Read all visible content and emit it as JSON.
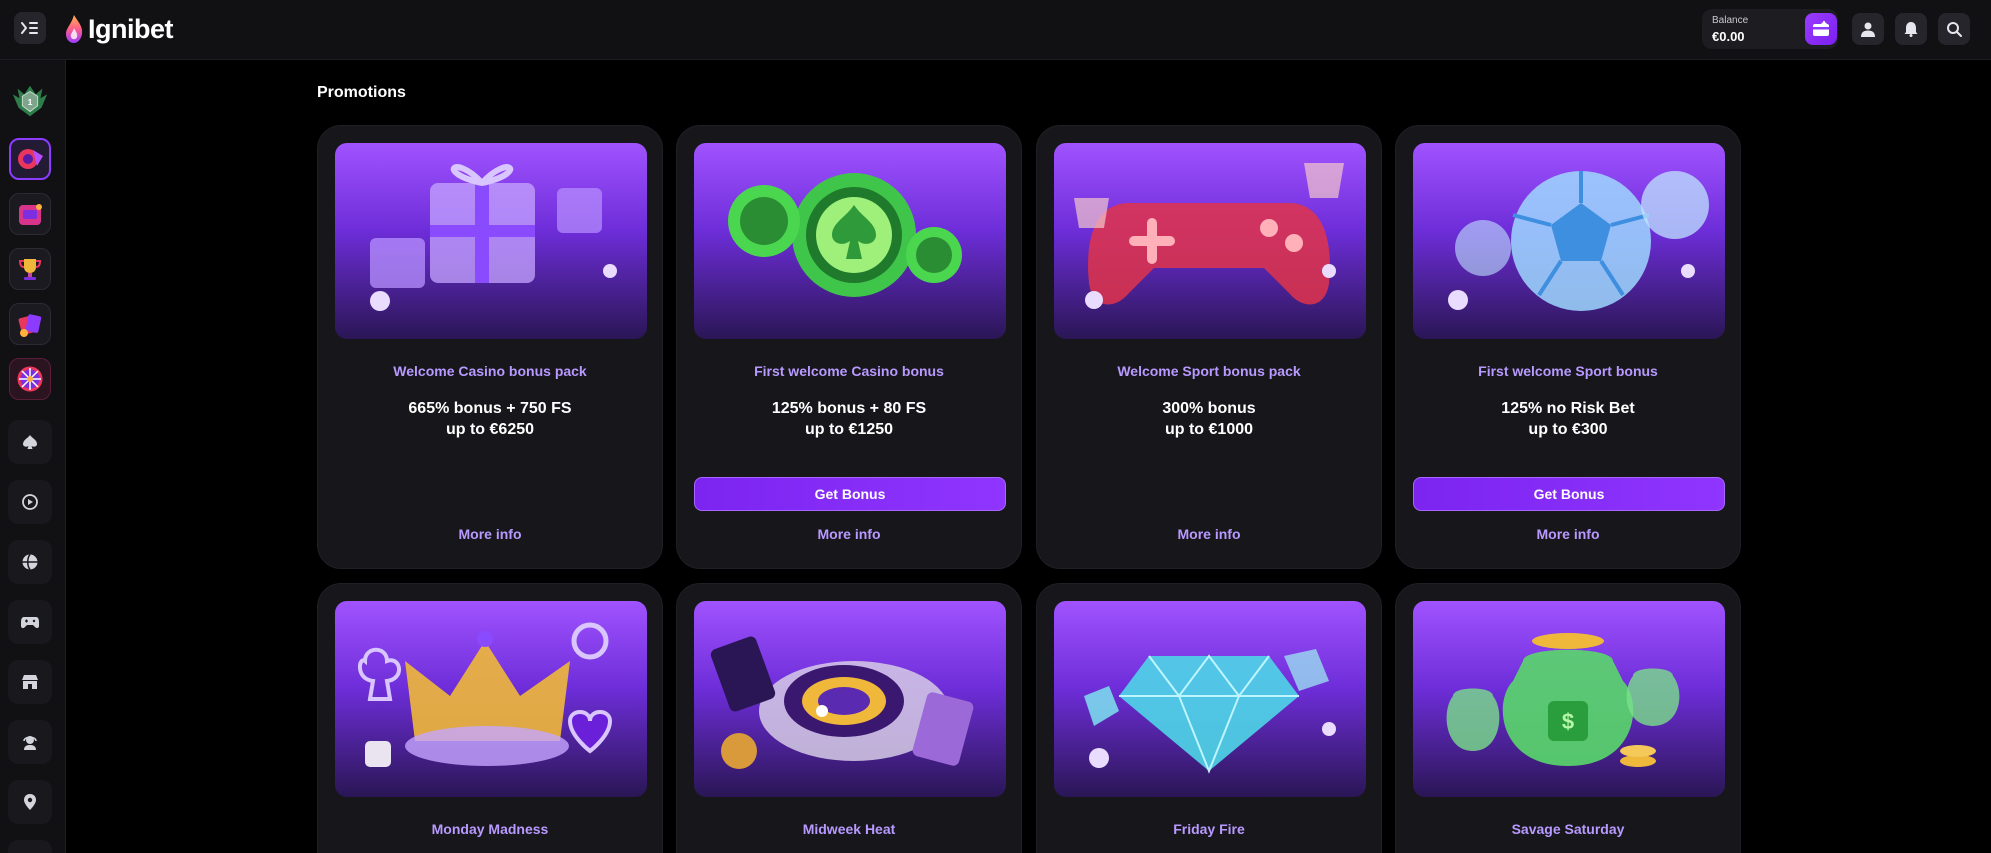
{
  "header": {
    "logo_text": "Ignibet",
    "balance_label": "Balance",
    "balance_value": "€0.00",
    "accent": "#8c3cff"
  },
  "sidebar": {
    "level_badge": "1",
    "game_icons": [
      "roulette-game-icon",
      "slots-game-icon",
      "trophy-game-icon",
      "cards-game-icon",
      "wheel-game-icon"
    ],
    "nav_icons": [
      "spade-icon",
      "live-casino-icon",
      "sports-ball-icon",
      "gamepad-icon",
      "store-icon",
      "support-agent-icon",
      "location-pin-icon"
    ]
  },
  "main": {
    "title": "Promotions",
    "promotions": [
      {
        "subtitle": "Welcome Casino bonus pack",
        "headline_1": "665% bonus + 750 FS",
        "headline_2": "up to €6250",
        "button": "",
        "more": "More info",
        "art": "gift-boxes"
      },
      {
        "subtitle": "First welcome Casino bonus",
        "headline_1": "125% bonus + 80 FS",
        "headline_2": "up to €1250",
        "button": "Get Bonus",
        "more": "More info",
        "art": "green-chips"
      },
      {
        "subtitle": "Welcome Sport bonus pack",
        "headline_1": "300% bonus",
        "headline_2": "up to €1000",
        "button": "",
        "more": "More info",
        "art": "red-gamepad"
      },
      {
        "subtitle": "First welcome Sport bonus",
        "headline_1": "125% no Risk Bet",
        "headline_2": "up to €300",
        "button": "Get Bonus",
        "more": "More info",
        "art": "football"
      },
      {
        "subtitle": "Monday Madness",
        "headline_1": "",
        "headline_2": "",
        "button": "",
        "more": "",
        "art": "crown"
      },
      {
        "subtitle": "Midweek Heat",
        "headline_1": "",
        "headline_2": "",
        "button": "",
        "more": "",
        "art": "roulette"
      },
      {
        "subtitle": "Friday Fire",
        "headline_1": "",
        "headline_2": "",
        "button": "",
        "more": "",
        "art": "diamond"
      },
      {
        "subtitle": "Savage Saturday",
        "headline_1": "",
        "headline_2": "",
        "button": "",
        "more": "",
        "art": "money-bags"
      }
    ]
  }
}
